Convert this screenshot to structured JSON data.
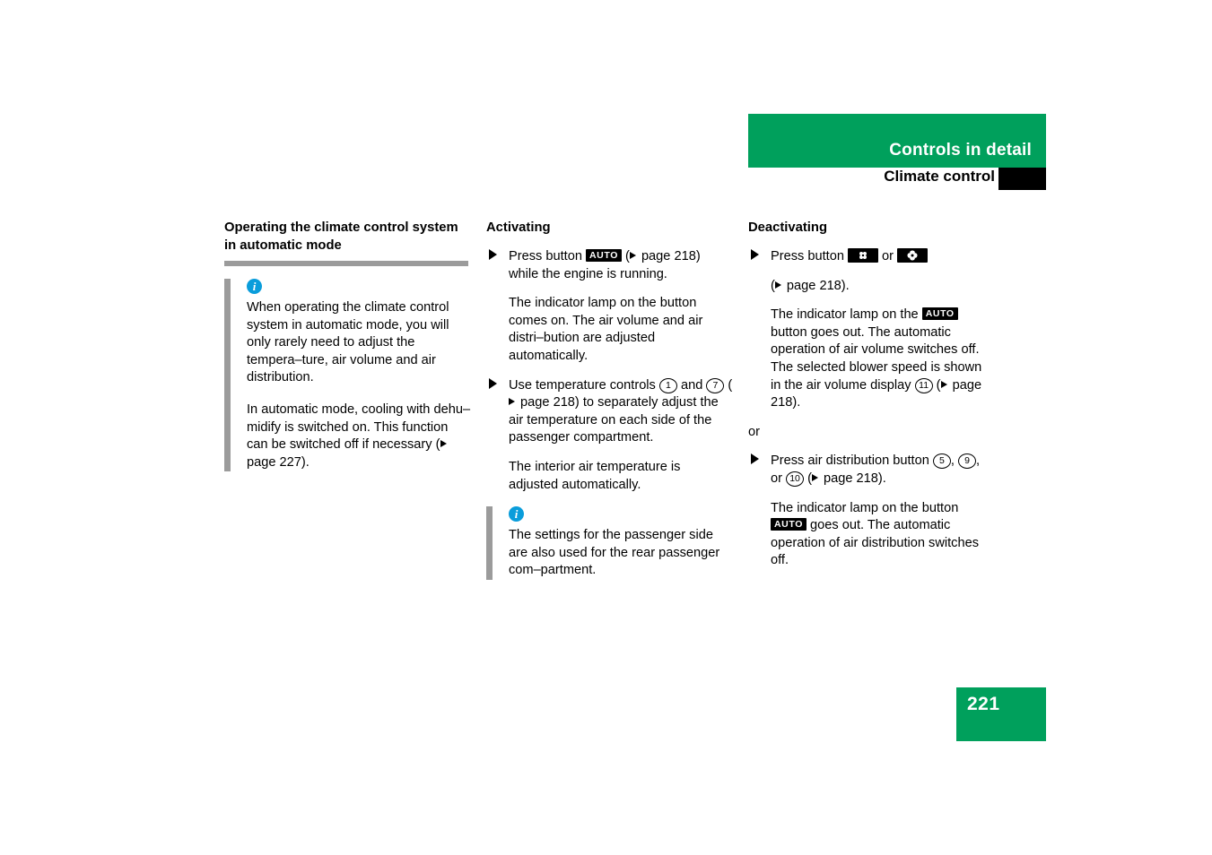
{
  "header": {
    "chapter_title": "Controls in detail",
    "section_title": "Climate control",
    "thumb_tab_label": ""
  },
  "footer": {
    "page_number": "221"
  },
  "columns": {
    "left": {
      "heading": "Operating the climate control system in automatic mode",
      "note": {
        "icon": "info-icon",
        "paragraphs": [
          "When operating the climate control system in automatic mode, you will only rarely need to adjust the tempera–ture, air volume and air distribution.",
          "In automatic mode, cooling with dehu–midify is switched on. This function can be switched off if necessary ( page 227)."
        ],
        "paragraph_2_prefix": "In automatic mode, cooling with dehu–midify is switched on. This function can be switched off if necessary (",
        "paragraph_2_ref": " page 227)."
      }
    },
    "mid": {
      "heading": "Activating",
      "step1": {
        "marker": "triangle-bullet",
        "text_before_badge": "Press button ",
        "badge_label": "AUTO",
        "text_after_badge_prefix": " (",
        "text_after_badge": " page 218) while the engine is running.",
        "result": "The indicator lamp on the button comes on. The air volume and air distri–bution are adjusted automatically."
      },
      "step2": {
        "marker": "triangle-bullet",
        "text_before_first_num": "Use temperature controls ",
        "num_1": "1",
        "text_between_nums": " and ",
        "num_2": "7",
        "text_after_nums_prefix": " (",
        "text_after_nums": " page 218) to separately adjust the air temperature on each side of the passenger compartment.",
        "result": "The interior air temperature is adjusted automatically."
      },
      "note": {
        "icon": "info-icon",
        "paragraphs": [
          "The settings for the passenger side are also used for the rear passenger com–partment."
        ]
      }
    },
    "right": {
      "heading": "Deactivating",
      "step1": {
        "marker": "triangle-bullet",
        "text_before_badges": "Press button ",
        "badge_1": "recirculation-fan-icon",
        "text_between_badges": " or ",
        "badge_2": "blower-fan-icon",
        "text_after_badges_prefix": "(",
        "text_after_badges": " page 218).",
        "result_before_badge": "The indicator lamp on the ",
        "result_badge_label": "AUTO",
        "result_after_badge": " button goes out. The automatic operation of air volume switches off. The selected blower speed is shown in the air volume display ",
        "result_num": "11",
        "result_tail_prefix": " (",
        "result_tail": " page 218)."
      },
      "or_label": "or",
      "step2": {
        "marker": "triangle-bullet",
        "text_before_nums": "Press air distribution button ",
        "num_1": "5",
        "sep_1": ", ",
        "num_2": "9",
        "sep_2": ", or ",
        "num_3": "10",
        "text_after_nums_prefix": " (",
        "text_after_nums": " page 218).",
        "result_before_badge": "The indicator lamp on the button ",
        "result_badge_label": "AUTO",
        "result_after_badge": " goes out. The automatic operation of air distribution switches off."
      }
    }
  },
  "colors": {
    "brand_green": "#00a05c",
    "note_bar_gray": "#9b9b9b",
    "info_blue": "#0a9ddb",
    "badge_black": "#000000"
  }
}
